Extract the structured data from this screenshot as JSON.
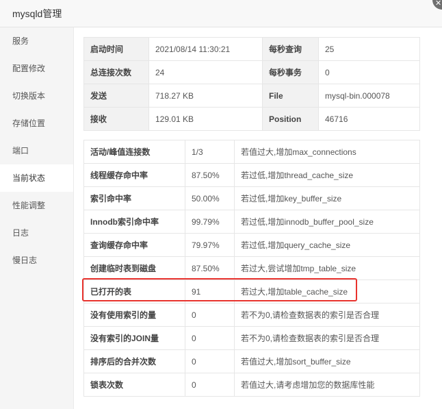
{
  "window": {
    "title": "mysqld管理",
    "close_glyph": "✕"
  },
  "sidebar": {
    "items": [
      {
        "label": "服务"
      },
      {
        "label": "配置修改"
      },
      {
        "label": "切换版本"
      },
      {
        "label": "存储位置"
      },
      {
        "label": "端口"
      },
      {
        "label": "当前状态",
        "active": true
      },
      {
        "label": "性能调整"
      },
      {
        "label": "日志"
      },
      {
        "label": "慢日志"
      }
    ]
  },
  "status_info": {
    "rows": [
      [
        {
          "label": "启动时间",
          "value": "2021/08/14 11:30:21"
        },
        {
          "label": "每秒查询",
          "value": "25"
        }
      ],
      [
        {
          "label": "总连接次数",
          "value": "24"
        },
        {
          "label": "每秒事务",
          "value": "0"
        }
      ],
      [
        {
          "label": "发送",
          "value": "718.27 KB"
        },
        {
          "label": "File",
          "value": "mysql-bin.000078"
        }
      ],
      [
        {
          "label": "接收",
          "value": "129.01 KB"
        },
        {
          "label": "Position",
          "value": "46716"
        }
      ]
    ]
  },
  "metrics": {
    "rows": [
      {
        "name": "活动/峰值连接数",
        "value": "1/3",
        "advice": "若值过大,增加max_connections"
      },
      {
        "name": "线程缓存命中率",
        "value": "87.50%",
        "advice": "若过低,增加thread_cache_size"
      },
      {
        "name": "索引命中率",
        "value": "50.00%",
        "advice": "若过低,增加key_buffer_size"
      },
      {
        "name": "Innodb索引命中率",
        "value": "99.79%",
        "advice": "若过低,增加innodb_buffer_pool_size"
      },
      {
        "name": "查询缓存命中率",
        "value": "79.97%",
        "advice": "若过低,增加query_cache_size"
      },
      {
        "name": "创建临时表到磁盘",
        "value": "87.50%",
        "advice": "若过大,尝试增加tmp_table_size"
      },
      {
        "name": "已打开的表",
        "value": "91",
        "advice": "若过大,增加table_cache_size",
        "highlighted": true
      },
      {
        "name": "没有使用索引的量",
        "value": "0",
        "advice": "若不为0,请检查数据表的索引是否合理"
      },
      {
        "name": "没有索引的JOIN量",
        "value": "0",
        "advice": "若不为0,请检查数据表的索引是否合理"
      },
      {
        "name": "排序后的合并次数",
        "value": "0",
        "advice": "若值过大,增加sort_buffer_size"
      },
      {
        "name": "锁表次数",
        "value": "0",
        "advice": "若值过大,请考虑增加您的数据库性能"
      }
    ]
  },
  "colors": {
    "highlight_border": "#e8322d",
    "label_bg": "#f2f2f2",
    "sidebar_bg": "#f5f5f5"
  }
}
